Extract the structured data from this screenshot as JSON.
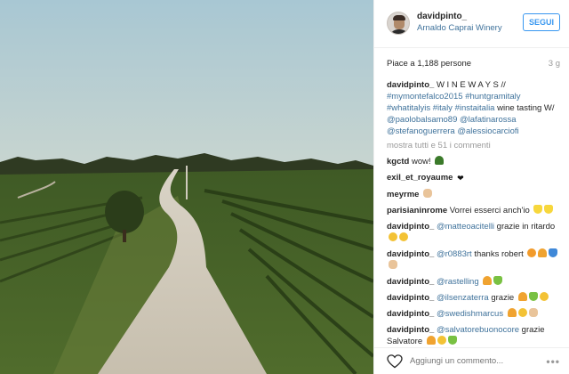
{
  "post": {
    "username": "davidpinto_",
    "location": "Arnaldo Caprai Winery",
    "follow_label": "SEGUI",
    "likes_text": "Piace a 1,188 persone",
    "time_ago": "3 g"
  },
  "caption": {
    "user": "davidpinto_",
    "text_before": " W I N E W A Y S // ",
    "tag1": "#mymontefalco2015",
    "tag2": "#huntgramitaly",
    "tag3": "#whatitalyis",
    "tag4": "#italy",
    "tag5": "#instaitalia",
    "text_mid": " wine tasting W/ ",
    "mention1": "@paolobalsamo89",
    "mention2": "@lafatinarossa",
    "mention3": "@stefanoguerrera",
    "mention4": "@alessiocarciofi"
  },
  "more_comments": "mostra tutti e 51 i commenti",
  "comments": [
    {
      "user": "kgctd",
      "text": " wow! "
    },
    {
      "user": "exil_et_royaume",
      "text": " "
    },
    {
      "user": "meyrme",
      "text": " "
    },
    {
      "user": "parisianinrome",
      "text": " Vorrei esserci anch'io "
    },
    {
      "user": "davidpinto_",
      "mention": "@matteoacitelli",
      "text": " grazie in ritardo "
    },
    {
      "user": "davidpinto_",
      "mention": "@r0883rt",
      "text": " thanks robert "
    },
    {
      "user": "davidpinto_",
      "mention": "@rastelling",
      "text": " "
    },
    {
      "user": "davidpinto_",
      "mention": "@ilsenzaterra",
      "text": " grazie "
    },
    {
      "user": "davidpinto_",
      "mention": "@swedishmarcus",
      "text": " "
    },
    {
      "user": "davidpinto_",
      "mention": "@salvatorebuonocore",
      "text": " grazie Salvatore "
    }
  ],
  "footer": {
    "placeholder": "Aggiungi un commento...",
    "more_label": "•••"
  },
  "icons": {
    "like": "heart-outline-icon",
    "more": "more-options-icon"
  },
  "colors": {
    "link": "#3f729b",
    "follow": "#3897f0"
  }
}
